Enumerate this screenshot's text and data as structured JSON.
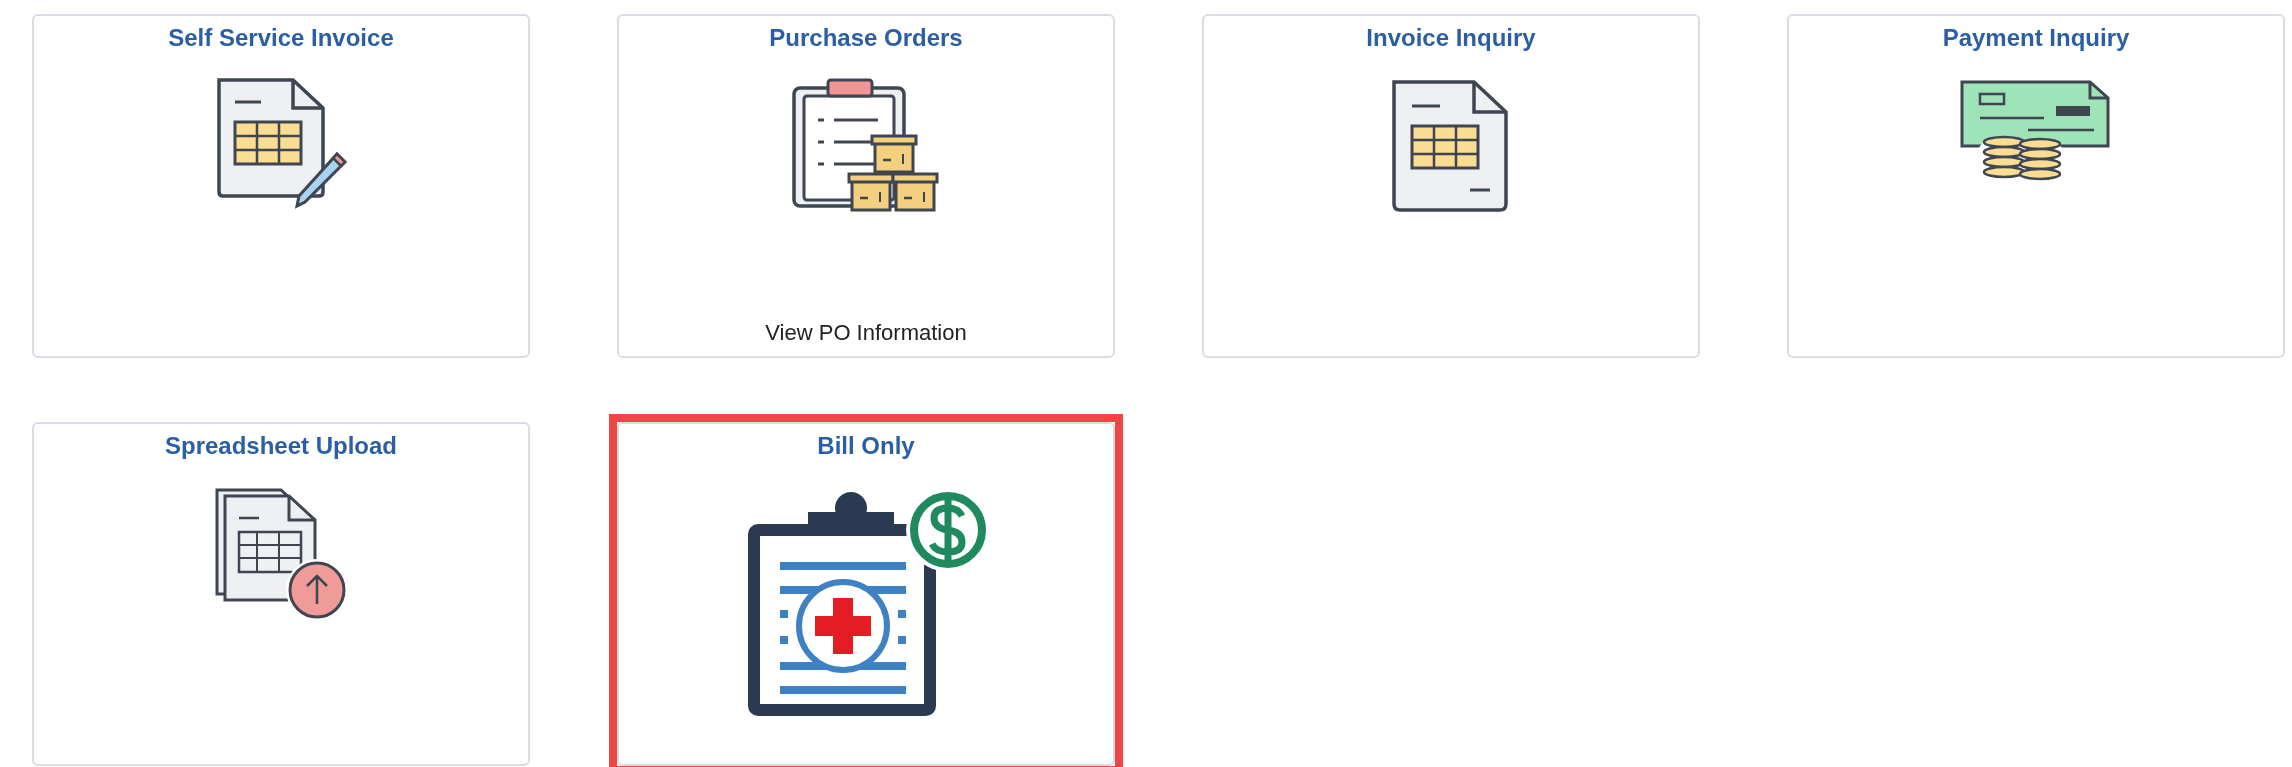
{
  "tiles": [
    {
      "title": "Self Service Invoice",
      "kind": "edit",
      "highlighted": false
    },
    {
      "title": "Purchase Orders",
      "kind": "orders",
      "subtitle": "View PO Information",
      "highlighted": false
    },
    {
      "title": "Invoice Inquiry",
      "kind": "inquiry",
      "highlighted": false
    },
    {
      "title": "Payment Inquiry",
      "kind": "payment",
      "highlighted": false
    },
    {
      "title": "Spreadsheet Upload",
      "kind": "upload",
      "highlighted": false
    },
    {
      "title": "Bill Only",
      "kind": "medical",
      "highlighted": true
    }
  ]
}
